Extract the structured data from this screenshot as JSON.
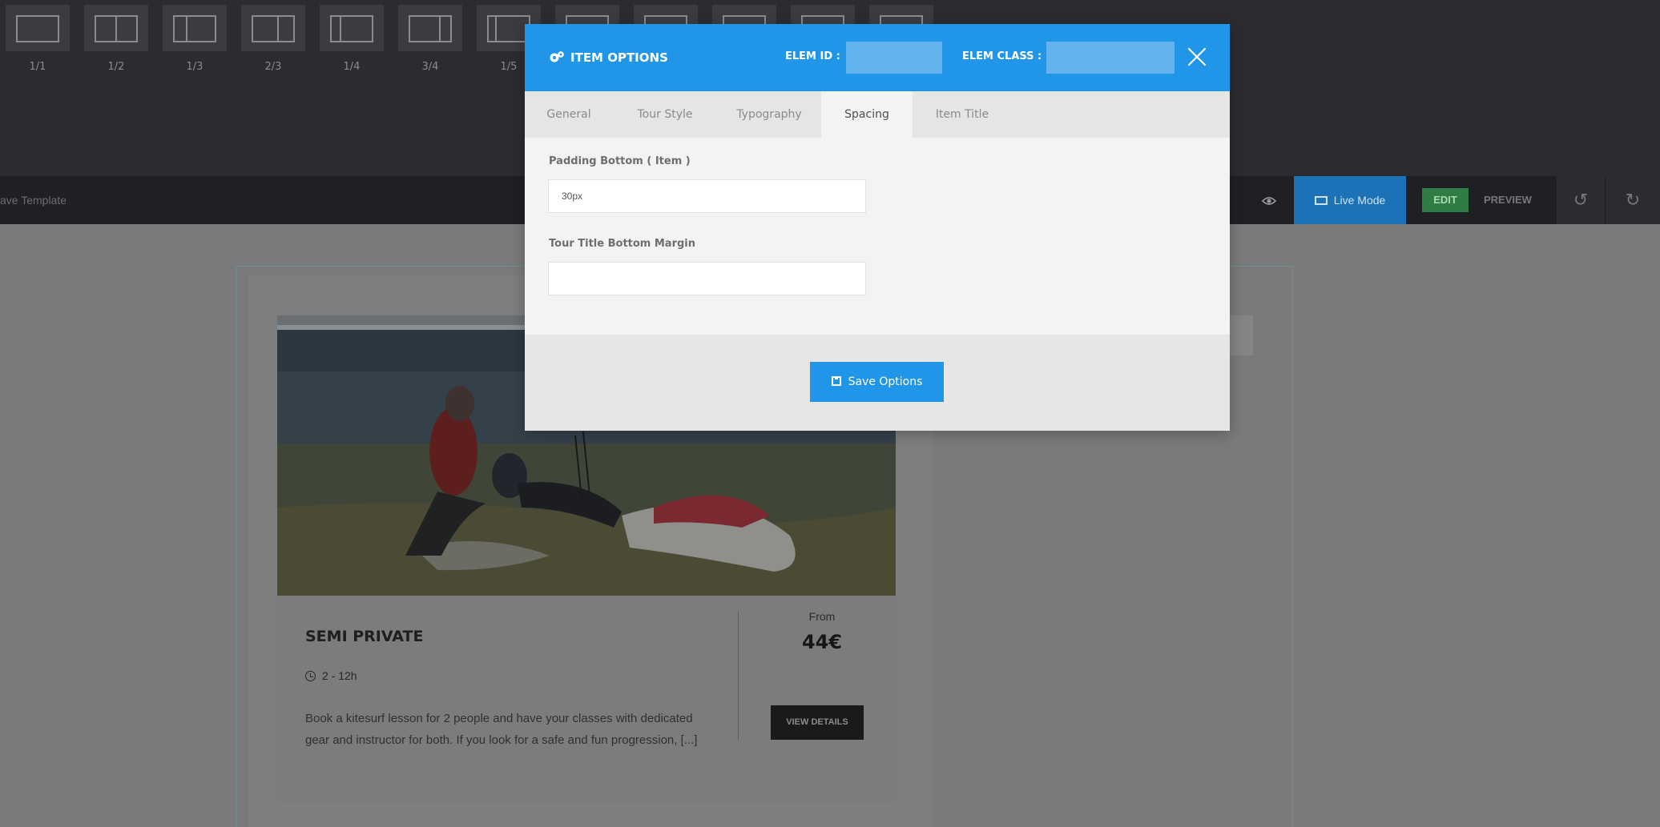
{
  "layout_bar": {
    "columns": [
      "1/1",
      "1/2",
      "1/3",
      "2/3",
      "1/4",
      "3/4",
      "1/5"
    ]
  },
  "toolbar": {
    "save_template": "ave Template",
    "live_mode": "Live Mode",
    "edit": "EDIT",
    "preview": "PREVIEW"
  },
  "modal": {
    "title": "ITEM OPTIONS",
    "elem_id_label": "ELEM ID :",
    "elem_class_label": "ELEM CLASS :",
    "tabs": [
      "General",
      "Tour Style",
      "Typography",
      "Spacing",
      "Item Title"
    ],
    "active_tab": "Spacing",
    "fields": {
      "padding_bottom_label": "Padding Bottom ( Item )",
      "padding_bottom_value": "30px",
      "tour_title_margin_label": "Tour Title Bottom Margin",
      "tour_title_margin_value": ""
    },
    "save_button": "Save Options",
    "accent_color": "#2196e8"
  },
  "tour_card": {
    "title": "SEMI PRIVATE",
    "duration": "2 - 12h",
    "description": "Book a kitesurf lesson for 2 people and have your classes with dedicated gear and instructor for both. If you look for a safe and fun progression, [...]",
    "from_label": "From",
    "price": "44€",
    "button": "VIEW DETAILS"
  }
}
